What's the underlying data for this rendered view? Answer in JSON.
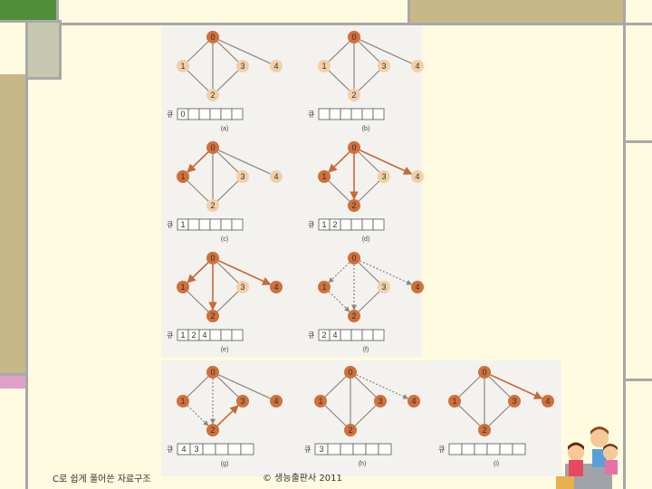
{
  "footer": {
    "left": "C로 쉽게 풀어쓴 자료구조",
    "center": "© 생능출판사 2011"
  },
  "queue_label": "큐",
  "steps": [
    {
      "caption": "(a)",
      "queue": [
        "0"
      ],
      "nodes": {
        "0": "visited",
        "1": "pale",
        "2": "pale",
        "3": "pale",
        "4": "pale"
      },
      "edges": {
        "01": "solid",
        "02": "solid",
        "03": "solid",
        "04": "solid",
        "12": "solid",
        "23": "solid"
      }
    },
    {
      "caption": "(b)",
      "queue": [],
      "nodes": {
        "0": "visited",
        "1": "pale",
        "2": "pale",
        "3": "pale",
        "4": "pale"
      },
      "edges": {
        "01": "solid",
        "02": "solid",
        "03": "solid",
        "04": "solid",
        "12": "solid",
        "23": "solid"
      }
    },
    {
      "caption": "(c)",
      "queue": [
        "1"
      ],
      "nodes": {
        "0": "visited",
        "1": "visited",
        "2": "pale",
        "3": "pale",
        "4": "pale"
      },
      "edges": {
        "01": "arrow",
        "02": "solid",
        "03": "solid",
        "04": "solid",
        "12": "solid",
        "23": "solid"
      }
    },
    {
      "caption": "(d)",
      "queue": [
        "1",
        "2"
      ],
      "nodes": {
        "0": "visited",
        "1": "visited",
        "2": "visited",
        "3": "pale",
        "4": "pale"
      },
      "edges": {
        "01": "arrow",
        "02": "arrow",
        "03": "solid",
        "04": "arrow",
        "12": "solid",
        "23": "solid"
      }
    },
    {
      "caption": "(e)",
      "queue": [
        "1",
        "2",
        "4"
      ],
      "nodes": {
        "0": "visited",
        "1": "visited",
        "2": "visited",
        "3": "pale",
        "4": "visited"
      },
      "edges": {
        "01": "arrow",
        "02": "arrow",
        "03": "solid",
        "04": "arrow",
        "12": "solid",
        "23": "solid"
      }
    },
    {
      "caption": "(f)",
      "queue": [
        "2",
        "4"
      ],
      "nodes": {
        "0": "visited",
        "1": "visited",
        "2": "visited",
        "3": "pale",
        "4": "visited"
      },
      "edges": {
        "01": "dotted",
        "02": "dotted",
        "03": "solid",
        "04": "dotted",
        "12": "dotted",
        "23": "solid"
      }
    },
    {
      "caption": "(g)",
      "queue": [
        "4",
        "3"
      ],
      "nodes": {
        "0": "visited",
        "1": "visited",
        "2": "visited",
        "3": "visited",
        "4": "visited"
      },
      "edges": {
        "01": "solid",
        "02": "dotted",
        "03": "solid",
        "04": "solid",
        "12": "dotted",
        "23": "arrow"
      }
    },
    {
      "caption": "(h)",
      "queue": [
        "3"
      ],
      "nodes": {
        "0": "visited",
        "1": "visited",
        "2": "visited",
        "3": "visited",
        "4": "visited"
      },
      "edges": {
        "01": "solid",
        "02": "solid",
        "03": "solid",
        "04": "dotted",
        "12": "solid",
        "23": "solid"
      }
    },
    {
      "caption": "(i)",
      "queue": [],
      "nodes": {
        "0": "visited",
        "1": "visited",
        "2": "visited",
        "3": "visited",
        "4": "visited"
      },
      "edges": {
        "01": "solid",
        "02": "solid",
        "03": "solid",
        "04": "arrow",
        "12": "solid",
        "23": "solid"
      }
    }
  ],
  "colors": {
    "visited": "#d0703a",
    "pale": "#f2cfa8",
    "edge": "#8a8680",
    "arrow": "#c56a3a"
  }
}
